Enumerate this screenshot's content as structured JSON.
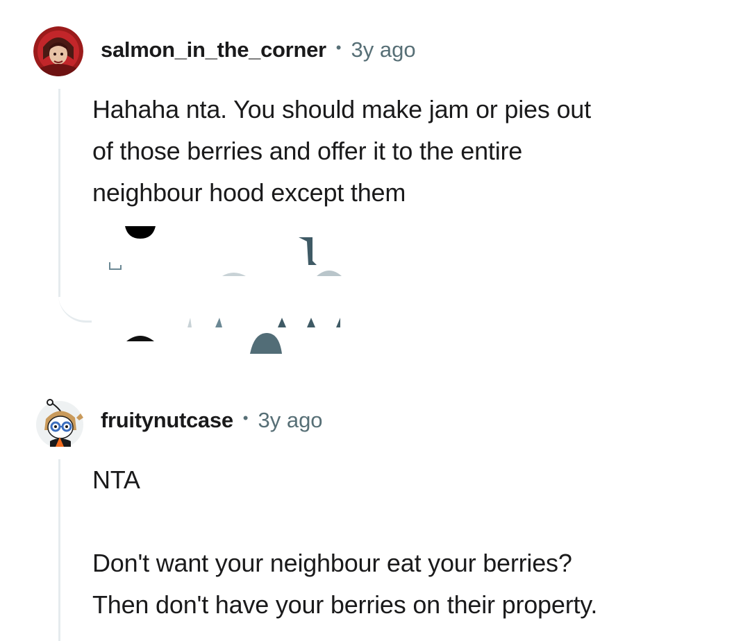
{
  "comments": [
    {
      "username": "salmon_in_the_corner",
      "separator": "•",
      "time": "3y ago",
      "avatar_icon": "red-hooded-character-avatar-icon",
      "body": [
        "Hahaha nta. You should make jam or pies out",
        "of those berries and offer it to the entire",
        "neighbour hood except them"
      ]
    },
    {
      "username": "fruitynutcase",
      "separator": "•",
      "time": "3y ago",
      "avatar_icon": "glasses-character-avatar-icon",
      "body_paragraphs": [
        "NTA",
        "Don't want your neighbour eat your berries?",
        "Then don't have your berries on their property."
      ]
    }
  ],
  "colors": {
    "text": "#1a1a1b",
    "meta": "#576f76",
    "thread_line": "#e5ebee"
  }
}
